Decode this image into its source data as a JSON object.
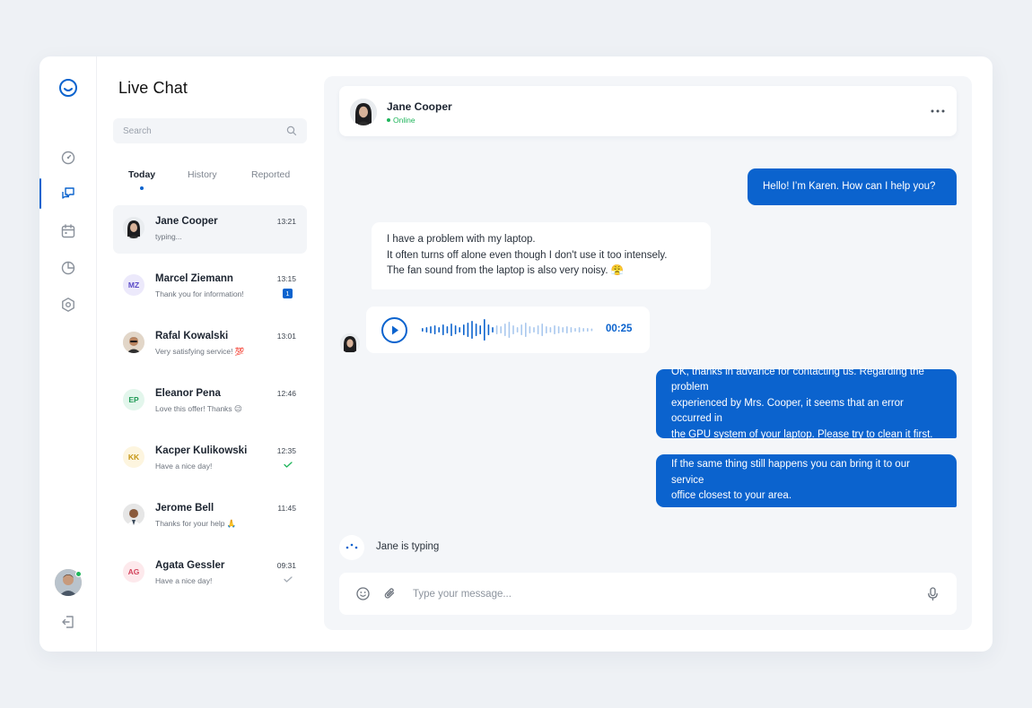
{
  "rail": {
    "items": [
      "dashboard-icon",
      "chat-icon",
      "calendar-icon",
      "chart-icon",
      "settings-icon"
    ],
    "active": "chat-icon",
    "brand_color": "#0b63ce",
    "online_color": "#1fb55b"
  },
  "list": {
    "title": "Live Chat",
    "search_placeholder": "Search",
    "tabs": [
      "Today",
      "History",
      "Reported"
    ],
    "active_tab": "Today",
    "conversations": [
      {
        "name": "Jane Cooper",
        "preview": "typing...",
        "time": "13:21",
        "initials": "",
        "selected": true
      },
      {
        "name": "Marcel Ziemann",
        "preview": "Thank you for information!",
        "time": "13:15",
        "initials": "MZ",
        "badge": "1"
      },
      {
        "name": "Rafal Kowalski",
        "preview": "Very satisfying service! 💯",
        "time": "13:01",
        "initials": ""
      },
      {
        "name": "Eleanor Pena",
        "preview": "Love this offer! Thanks 😉",
        "time": "12:46",
        "initials": "EP"
      },
      {
        "name": "Kacper Kulikowski",
        "preview": "Have a nice day!",
        "time": "12:35",
        "initials": "KK",
        "status": "read"
      },
      {
        "name": "Jerome Bell",
        "preview": "Thanks for your help 🙏",
        "time": "11:45",
        "initials": ""
      },
      {
        "name": "Agata Gessler",
        "preview": "Have a nice day!",
        "time": "09:31",
        "initials": "AG",
        "status": "sent"
      }
    ]
  },
  "chat": {
    "contact_name": "Jane Cooper",
    "contact_status": "Online",
    "messages": [
      {
        "from": "agent",
        "text": "Hello! I’m Karen. How can I help you?"
      },
      {
        "from": "customer",
        "text": "I have a problem with my laptop.\nIt often turns off alone even though I don't use it too intensely.\nThe fan sound from the laptop is also very noisy. 😤"
      },
      {
        "from": "customer",
        "type": "voice",
        "duration": "00:25"
      },
      {
        "from": "agent",
        "text": "OK, thanks in advance for contacting us. Regarding the problem\nexperienced by Mrs. Cooper, it seems that an error occurred in\nthe GPU system of your laptop. Please try to clean it first."
      },
      {
        "from": "agent",
        "text": "If the same thing still happens you can bring it to our service\noffice closest to your area."
      }
    ],
    "typing_label": "Jane is typing",
    "composer_placeholder": "Type your message..."
  }
}
